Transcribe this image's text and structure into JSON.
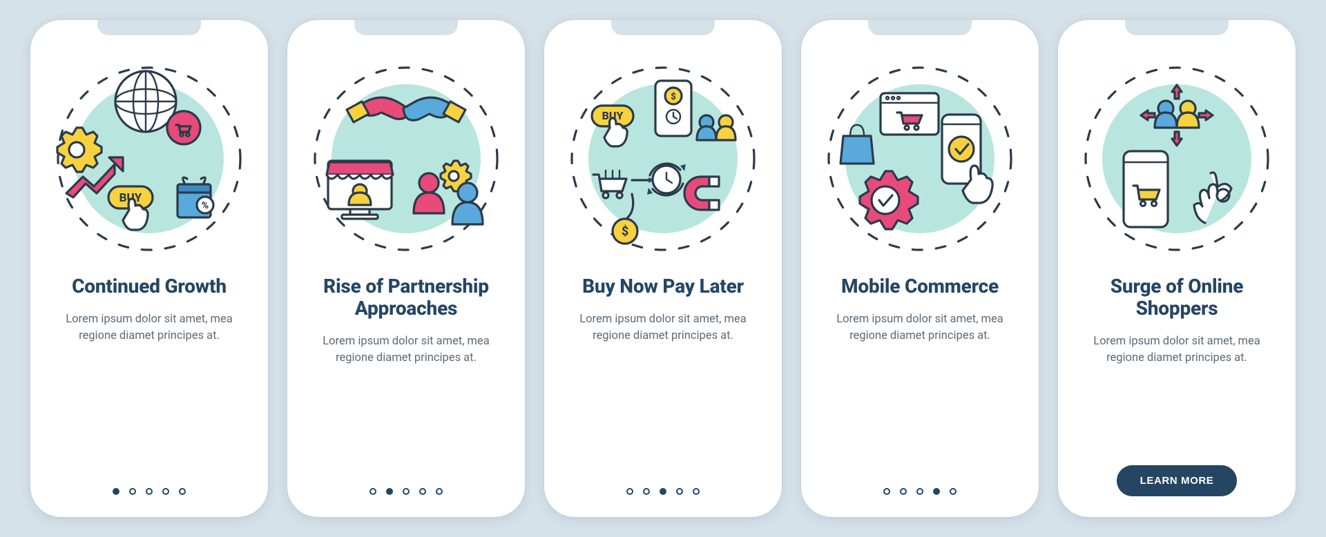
{
  "slide_count": 5,
  "cta_label": "LEARN MORE",
  "body_text": "Lorem ipsum dolor sit amet, mea regione diamet principes at.",
  "slides": [
    {
      "title": "Continued Growth",
      "icon_name": "continued-growth-illustration-icon",
      "active_index": 0
    },
    {
      "title": "Rise of Partnership Approaches",
      "icon_name": "partnership-approaches-illustration-icon",
      "active_index": 1
    },
    {
      "title": "Buy Now Pay Later",
      "icon_name": "buy-now-pay-later-illustration-icon",
      "active_index": 2
    },
    {
      "title": "Mobile Commerce",
      "icon_name": "mobile-commerce-illustration-icon",
      "active_index": 3
    },
    {
      "title": "Surge of Online Shoppers",
      "icon_name": "online-shoppers-surge-illustration-icon",
      "active_index": 4
    }
  ]
}
